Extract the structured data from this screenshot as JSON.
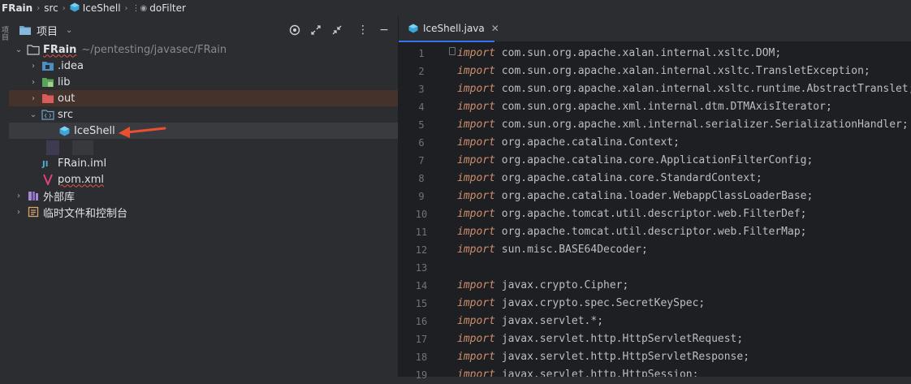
{
  "breadcrumb": {
    "project": "FRain",
    "folder": "src",
    "file": "IceShell",
    "method": "doFilter"
  },
  "sidebar_strip": {
    "label": "项目"
  },
  "project_panel": {
    "title": "项目",
    "tree": {
      "root": {
        "name": "FRain",
        "path": "~/pentesting/javasec/FRain"
      },
      "idea": ".idea",
      "lib": "lib",
      "out": "out",
      "src": "src",
      "iceshell": "IceShell",
      "iml": "FRain.iml",
      "pom": "pom.xml",
      "external": "外部库",
      "scratches": "临时文件和控制台"
    }
  },
  "editor": {
    "tab": "IceShell.java",
    "keyword": "import",
    "lines": [
      {
        "n": "1",
        "kw": "import",
        "t": " com.sun.org.apache.xalan.internal.xsltc.DOM;"
      },
      {
        "n": "2",
        "kw": "import",
        "t": " com.sun.org.apache.xalan.internal.xsltc.TransletException;"
      },
      {
        "n": "3",
        "kw": "import",
        "t": " com.sun.org.apache.xalan.internal.xsltc.runtime.AbstractTranslet;"
      },
      {
        "n": "4",
        "kw": "import",
        "t": " com.sun.org.apache.xml.internal.dtm.DTMAxisIterator;"
      },
      {
        "n": "5",
        "kw": "import",
        "t": " com.sun.org.apache.xml.internal.serializer.SerializationHandler;"
      },
      {
        "n": "6",
        "kw": "import",
        "t": " org.apache.catalina.Context;"
      },
      {
        "n": "7",
        "kw": "import",
        "t": " org.apache.catalina.core.ApplicationFilterConfig;"
      },
      {
        "n": "8",
        "kw": "import",
        "t": " org.apache.catalina.core.StandardContext;"
      },
      {
        "n": "9",
        "kw": "import",
        "t": " org.apache.catalina.loader.WebappClassLoaderBase;"
      },
      {
        "n": "10",
        "kw": "import",
        "t": " org.apache.tomcat.util.descriptor.web.FilterDef;"
      },
      {
        "n": "11",
        "kw": "import",
        "t": " org.apache.tomcat.util.descriptor.web.FilterMap;"
      },
      {
        "n": "12",
        "kw": "import",
        "t": " sun.misc.BASE64Decoder;"
      },
      {
        "n": "13",
        "kw": "",
        "t": ""
      },
      {
        "n": "14",
        "kw": "import",
        "t": " javax.crypto.Cipher;"
      },
      {
        "n": "15",
        "kw": "import",
        "t": " javax.crypto.spec.SecretKeySpec;"
      },
      {
        "n": "16",
        "kw": "import",
        "t": " javax.servlet.*;"
      },
      {
        "n": "17",
        "kw": "import",
        "t": " javax.servlet.http.HttpServletRequest;"
      },
      {
        "n": "18",
        "kw": "import",
        "t": " javax.servlet.http.HttpServletResponse;"
      },
      {
        "n": "19",
        "kw": "import",
        "t": " javax.servlet.http.HttpSession;"
      }
    ]
  },
  "colors": {
    "accent": "#3574f0",
    "keyword": "#cf8e6d",
    "arrow": "#e8502f"
  }
}
